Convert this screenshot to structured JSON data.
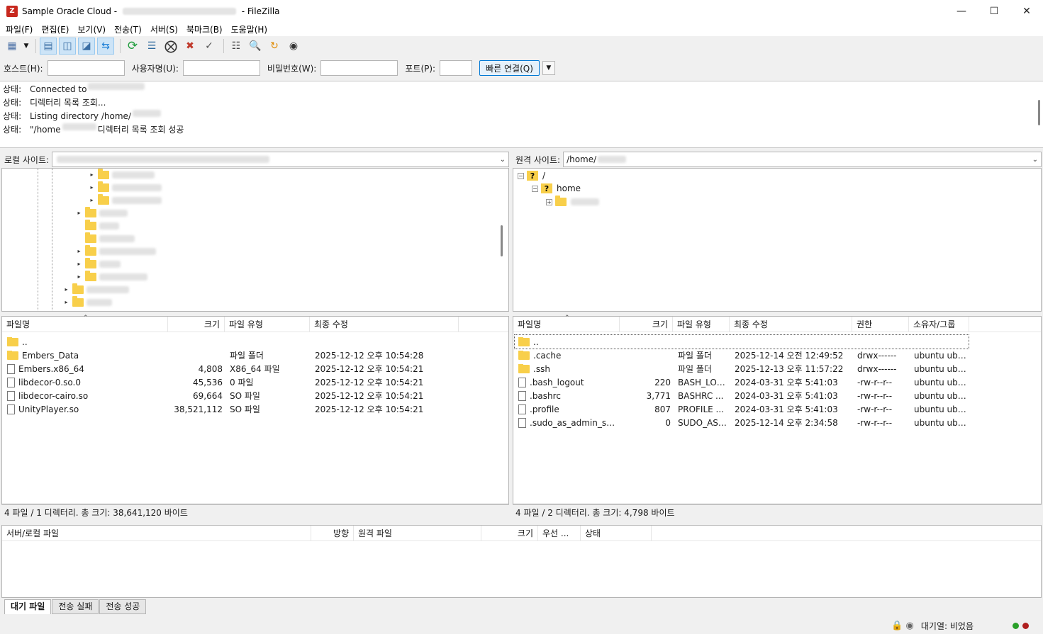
{
  "window": {
    "title_prefix": "Sample Oracle Cloud - ",
    "title_suffix": " - FileZilla",
    "app_icon_text": "Z"
  },
  "menu": [
    "파일(F)",
    "편집(E)",
    "보기(V)",
    "전송(T)",
    "서버(S)",
    "북마크(B)",
    "도움말(H)"
  ],
  "quickconnect": {
    "host_label": "호스트(H):",
    "user_label": "사용자명(U):",
    "pass_label": "비밀번호(W):",
    "port_label": "포트(P):",
    "connect_label": "빠른 연결(Q)"
  },
  "log": [
    {
      "label": "상태:",
      "text": "Connected to "
    },
    {
      "label": "상태:",
      "text": "디렉터리 목록 조회..."
    },
    {
      "label": "상태:",
      "text": "Listing directory /home/"
    },
    {
      "label": "상태:",
      "text": "\"/home",
      "text2": " 디렉터리 목록 조회 성공"
    }
  ],
  "local": {
    "site_label": "로컬 사이트:",
    "headers": [
      "파일명",
      "크기",
      "파일 유형",
      "최종 수정"
    ],
    "files": [
      {
        "name": "..",
        "size": "",
        "type": "",
        "modified": "",
        "icon": "folder"
      },
      {
        "name": "Embers_Data",
        "size": "",
        "type": "파일 폴더",
        "modified": "2025-12-12 오후 10:54:28",
        "icon": "folder"
      },
      {
        "name": "Embers.x86_64",
        "size": "4,808",
        "type": "X86_64 파일",
        "modified": "2025-12-12 오후 10:54:21",
        "icon": "file"
      },
      {
        "name": "libdecor-0.so.0",
        "size": "45,536",
        "type": "0 파일",
        "modified": "2025-12-12 오후 10:54:21",
        "icon": "file"
      },
      {
        "name": "libdecor-cairo.so",
        "size": "69,664",
        "type": "SO 파일",
        "modified": "2025-12-12 오후 10:54:21",
        "icon": "file"
      },
      {
        "name": "UnityPlayer.so",
        "size": "38,521,112",
        "type": "SO 파일",
        "modified": "2025-12-12 오후 10:54:21",
        "icon": "file"
      }
    ],
    "status": "4 파일 / 1 디렉터리. 총 크기: 38,641,120 바이트"
  },
  "remote": {
    "site_label": "원격 사이트:",
    "path": "/home/",
    "tree": [
      {
        "label": "/"
      },
      {
        "label": "home"
      }
    ],
    "headers": [
      "파일명",
      "크기",
      "파일 유형",
      "최종 수정",
      "권한",
      "소유자/그룹"
    ],
    "files": [
      {
        "name": "..",
        "size": "",
        "type": "",
        "modified": "",
        "perm": "",
        "owner": "",
        "icon": "folder"
      },
      {
        "name": ".cache",
        "size": "",
        "type": "파일 폴더",
        "modified": "2025-12-14 오전 12:49:52",
        "perm": "drwx------",
        "owner": "ubuntu ubu...",
        "icon": "folder"
      },
      {
        "name": ".ssh",
        "size": "",
        "type": "파일 폴더",
        "modified": "2025-12-13 오후 11:57:22",
        "perm": "drwx------",
        "owner": "ubuntu ubu...",
        "icon": "folder"
      },
      {
        "name": ".bash_logout",
        "size": "220",
        "type": "BASH_LOG...",
        "modified": "2024-03-31 오후 5:41:03",
        "perm": "-rw-r--r--",
        "owner": "ubuntu ubu...",
        "icon": "file"
      },
      {
        "name": ".bashrc",
        "size": "3,771",
        "type": "BASHRC ...",
        "modified": "2024-03-31 오후 5:41:03",
        "perm": "-rw-r--r--",
        "owner": "ubuntu ubu...",
        "icon": "file"
      },
      {
        "name": ".profile",
        "size": "807",
        "type": "PROFILE ...",
        "modified": "2024-03-31 오후 5:41:03",
        "perm": "-rw-r--r--",
        "owner": "ubuntu ubu...",
        "icon": "file"
      },
      {
        "name": ".sudo_as_admin_succ...",
        "size": "0",
        "type": "SUDO_AS_...",
        "modified": "2025-12-14 오후 2:34:58",
        "perm": "-rw-r--r--",
        "owner": "ubuntu ubu...",
        "icon": "file"
      }
    ],
    "status": "4 파일 / 2 디렉터리. 총 크기: 4,798 바이트"
  },
  "queue": {
    "headers": [
      "서버/로컬 파일",
      "방향",
      "원격 파일",
      "크기",
      "우선 ...",
      "상태"
    ],
    "tabs": [
      "대기 파일",
      "전송 실패",
      "전송 성공"
    ]
  },
  "statusbar": {
    "queue_text": "대기열: 비었음"
  },
  "colors": {
    "folder": "#f8cf4a",
    "led_green": "#2aa02a",
    "led_red": "#b02020",
    "accent": "#0078d4"
  }
}
